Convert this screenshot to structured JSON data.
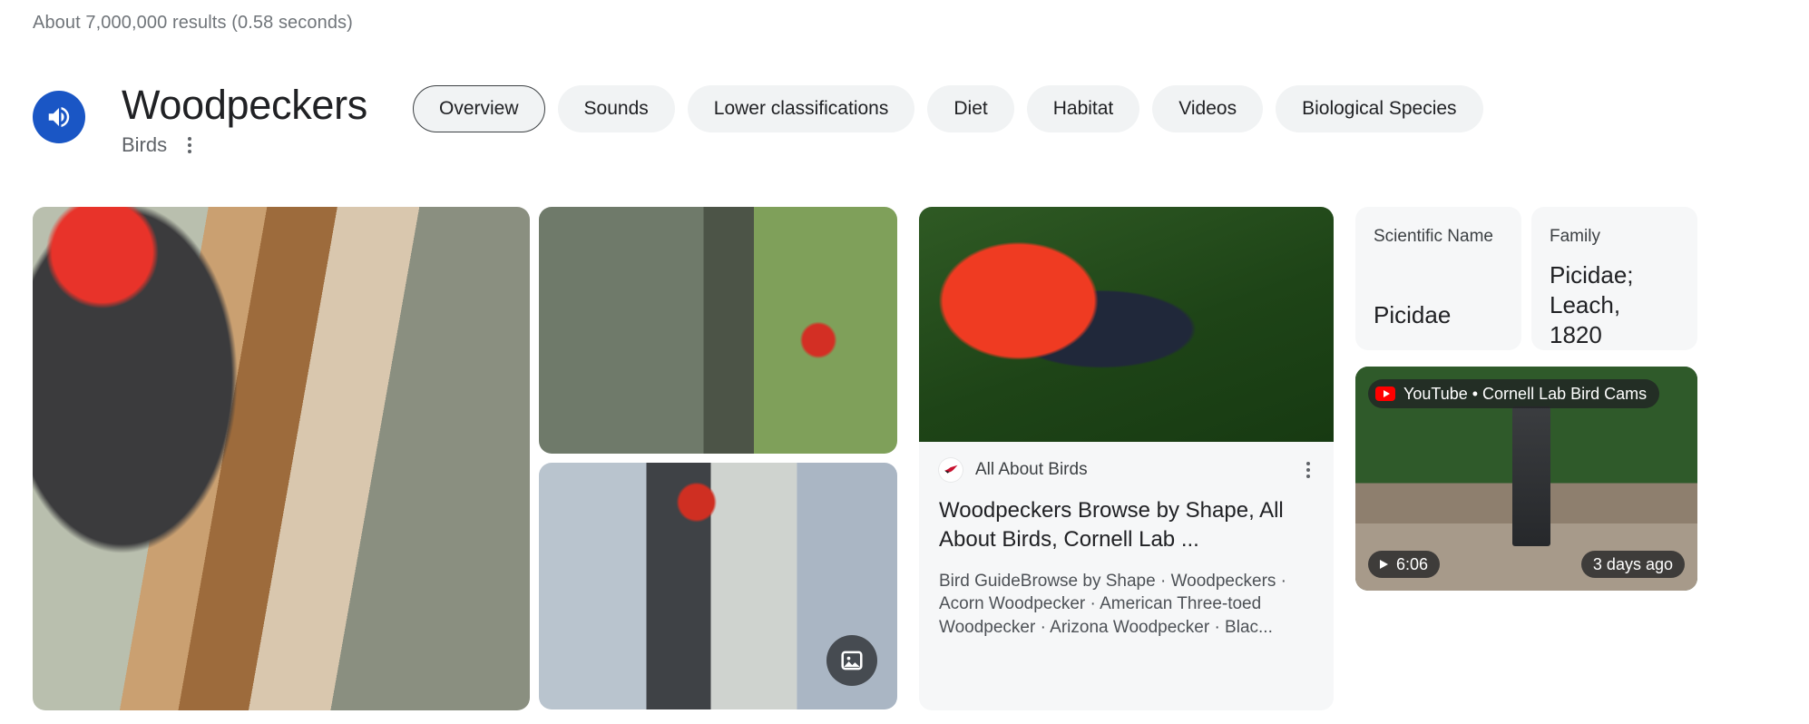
{
  "results_count": "About 7,000,000 results (0.58 seconds)",
  "knowledge_panel": {
    "title": "Woodpeckers",
    "subtitle": "Birds",
    "audio_icon": "speaker-icon",
    "menu_icon": "more-vertical-icon"
  },
  "tabs": [
    {
      "label": "Overview",
      "selected": true
    },
    {
      "label": "Sounds",
      "selected": false
    },
    {
      "label": "Lower classifications",
      "selected": false
    },
    {
      "label": "Diet",
      "selected": false
    },
    {
      "label": "Habitat",
      "selected": false
    },
    {
      "label": "Videos",
      "selected": false
    },
    {
      "label": "Biological Species",
      "selected": false
    }
  ],
  "gallery": {
    "fab_icon": "image-gallery-icon",
    "images": [
      {
        "alt": "Pileated woodpecker on shredded tree trunk"
      },
      {
        "alt": "Pileated woodpecker clinging to mossy trunk"
      },
      {
        "alt": "Pileated woodpecker on birch tree"
      }
    ]
  },
  "result_card": {
    "source": "All About Birds",
    "favicon": "bird-favicon",
    "menu_icon": "more-vertical-icon",
    "title": "Woodpeckers Browse by Shape, All About Birds, Cornell Lab ...",
    "snippet": "Bird GuideBrowse by Shape · Woodpeckers · Acorn Woodpecker · American Three-toed Woodpecker · Arizona Woodpecker · Blac...",
    "thumb_alt": "Scarlet tanager perched on a branch"
  },
  "facts": [
    {
      "label": "Scientific Name",
      "value": "Picidae"
    },
    {
      "label": "Family",
      "value": "Picidae; Leach, 1820"
    }
  ],
  "video_card": {
    "platform": "YouTube",
    "channel": "Cornell Lab Bird Cams",
    "pill_text": "YouTube • Cornell Lab Bird Cams",
    "duration": "6:06",
    "published": "3 days ago",
    "youtube_icon": "youtube-icon",
    "play_icon": "play-icon",
    "thumb_alt": "Woodpecker at a backyard bird feeder"
  },
  "colors": {
    "accent_blue": "#1a56c5",
    "chip_bg": "#f1f3f4",
    "card_bg": "#f6f7f8",
    "text_primary": "#202124",
    "text_secondary": "#5f6368",
    "youtube_red": "#ff0000"
  }
}
